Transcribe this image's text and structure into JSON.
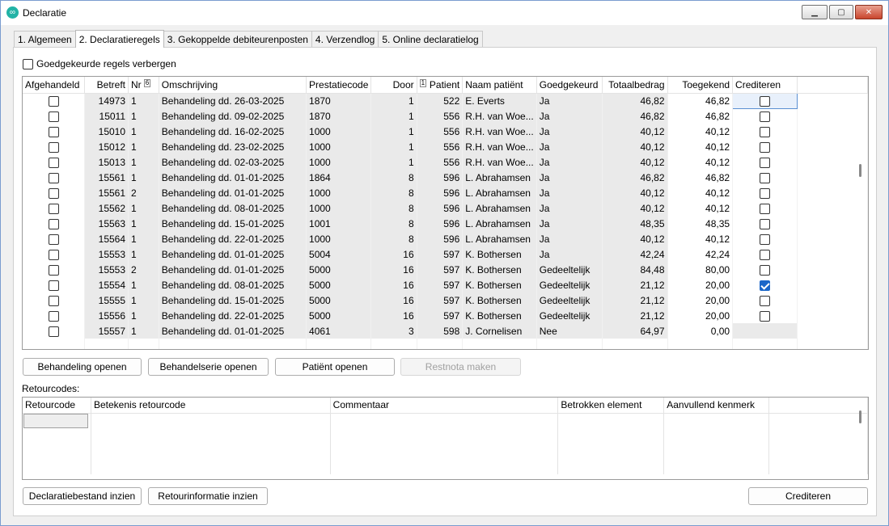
{
  "window": {
    "title": "Declaratie"
  },
  "tabs": [
    {
      "label": "1. Algemeen"
    },
    {
      "label": "2. Declaratieregels"
    },
    {
      "label": "3. Gekoppelde debiteurenposten"
    },
    {
      "label": "4. Verzendlog"
    },
    {
      "label": "5. Online declaratielog"
    }
  ],
  "filter": {
    "hide_approved_label": "Goedgekeurde regels verbergen"
  },
  "grid": {
    "columns": {
      "afgehandeld": "Afgehandeld",
      "betreft": "Betreft",
      "nr": "Nr",
      "nr_sort": "6",
      "omschrijving": "Omschrijving",
      "prestatiecode": "Prestatiecode",
      "door": "Door",
      "patient_sort": "1",
      "patient": "Patient",
      "naam": "Naam patiënt",
      "goedgekeurd": "Goedgekeurd",
      "totaalbedrag": "Totaalbedrag",
      "toegekend": "Toegekend",
      "crediteren": "Crediteren"
    },
    "rows": [
      {
        "betreft": "14973",
        "nr": "1",
        "omschrijving": "Behandeling dd. 26-03-2025",
        "prestatiecode": "1870",
        "door": "1",
        "patient": "522",
        "naam": "E. Everts",
        "goedgekeurd": "Ja",
        "totaalbedrag": "46,82",
        "toegekend": "46,82",
        "crediteren": false
      },
      {
        "betreft": "15011",
        "nr": "1",
        "omschrijving": "Behandeling dd. 09-02-2025",
        "prestatiecode": "1870",
        "door": "1",
        "patient": "556",
        "naam": "R.H. van Woe...",
        "goedgekeurd": "Ja",
        "totaalbedrag": "46,82",
        "toegekend": "46,82",
        "crediteren": false
      },
      {
        "betreft": "15010",
        "nr": "1",
        "omschrijving": "Behandeling dd. 16-02-2025",
        "prestatiecode": "1000",
        "door": "1",
        "patient": "556",
        "naam": "R.H. van Woe...",
        "goedgekeurd": "Ja",
        "totaalbedrag": "40,12",
        "toegekend": "40,12",
        "crediteren": false
      },
      {
        "betreft": "15012",
        "nr": "1",
        "omschrijving": "Behandeling dd. 23-02-2025",
        "prestatiecode": "1000",
        "door": "1",
        "patient": "556",
        "naam": "R.H. van Woe...",
        "goedgekeurd": "Ja",
        "totaalbedrag": "40,12",
        "toegekend": "40,12",
        "crediteren": false
      },
      {
        "betreft": "15013",
        "nr": "1",
        "omschrijving": "Behandeling dd. 02-03-2025",
        "prestatiecode": "1000",
        "door": "1",
        "patient": "556",
        "naam": "R.H. van Woe...",
        "goedgekeurd": "Ja",
        "totaalbedrag": "40,12",
        "toegekend": "40,12",
        "crediteren": false
      },
      {
        "betreft": "15561",
        "nr": "1",
        "omschrijving": "Behandeling dd. 01-01-2025",
        "prestatiecode": "1864",
        "door": "8",
        "patient": "596",
        "naam": "L. Abrahamsen",
        "goedgekeurd": "Ja",
        "totaalbedrag": "46,82",
        "toegekend": "46,82",
        "crediteren": false
      },
      {
        "betreft": "15561",
        "nr": "2",
        "omschrijving": "Behandeling dd. 01-01-2025",
        "prestatiecode": "1000",
        "door": "8",
        "patient": "596",
        "naam": "L. Abrahamsen",
        "goedgekeurd": "Ja",
        "totaalbedrag": "40,12",
        "toegekend": "40,12",
        "crediteren": false
      },
      {
        "betreft": "15562",
        "nr": "1",
        "omschrijving": "Behandeling dd. 08-01-2025",
        "prestatiecode": "1000",
        "door": "8",
        "patient": "596",
        "naam": "L. Abrahamsen",
        "goedgekeurd": "Ja",
        "totaalbedrag": "40,12",
        "toegekend": "40,12",
        "crediteren": false
      },
      {
        "betreft": "15563",
        "nr": "1",
        "omschrijving": "Behandeling dd. 15-01-2025",
        "prestatiecode": "1001",
        "door": "8",
        "patient": "596",
        "naam": "L. Abrahamsen",
        "goedgekeurd": "Ja",
        "totaalbedrag": "48,35",
        "toegekend": "48,35",
        "crediteren": false
      },
      {
        "betreft": "15564",
        "nr": "1",
        "omschrijving": "Behandeling dd. 22-01-2025",
        "prestatiecode": "1000",
        "door": "8",
        "patient": "596",
        "naam": "L. Abrahamsen",
        "goedgekeurd": "Ja",
        "totaalbedrag": "40,12",
        "toegekend": "40,12",
        "crediteren": false
      },
      {
        "betreft": "15553",
        "nr": "1",
        "omschrijving": "Behandeling dd. 01-01-2025",
        "prestatiecode": "5004",
        "door": "16",
        "patient": "597",
        "naam": "K. Bothersen",
        "goedgekeurd": "Ja",
        "totaalbedrag": "42,24",
        "toegekend": "42,24",
        "crediteren": false
      },
      {
        "betreft": "15553",
        "nr": "2",
        "omschrijving": "Behandeling dd. 01-01-2025",
        "prestatiecode": "5000",
        "door": "16",
        "patient": "597",
        "naam": "K. Bothersen",
        "goedgekeurd": "Gedeeltelijk",
        "totaalbedrag": "84,48",
        "toegekend": "80,00",
        "crediteren": false
      },
      {
        "betreft": "15554",
        "nr": "1",
        "omschrijving": "Behandeling dd. 08-01-2025",
        "prestatiecode": "5000",
        "door": "16",
        "patient": "597",
        "naam": "K. Bothersen",
        "goedgekeurd": "Gedeeltelijk",
        "totaalbedrag": "21,12",
        "toegekend": "20,00",
        "crediteren": true
      },
      {
        "betreft": "15555",
        "nr": "1",
        "omschrijving": "Behandeling dd. 15-01-2025",
        "prestatiecode": "5000",
        "door": "16",
        "patient": "597",
        "naam": "K. Bothersen",
        "goedgekeurd": "Gedeeltelijk",
        "totaalbedrag": "21,12",
        "toegekend": "20,00",
        "crediteren": false
      },
      {
        "betreft": "15556",
        "nr": "1",
        "omschrijving": "Behandeling dd. 22-01-2025",
        "prestatiecode": "5000",
        "door": "16",
        "patient": "597",
        "naam": "K. Bothersen",
        "goedgekeurd": "Gedeeltelijk",
        "totaalbedrag": "21,12",
        "toegekend": "20,00",
        "crediteren": false
      },
      {
        "betreft": "15557",
        "nr": "1",
        "omschrijving": "Behandeling dd. 01-01-2025",
        "prestatiecode": "4061",
        "door": "3",
        "patient": "598",
        "naam": "J. Cornelisen",
        "goedgekeurd": "Nee",
        "totaalbedrag": "64,97",
        "toegekend": "0,00",
        "crediteren": null
      }
    ]
  },
  "actions": {
    "behandeling_openen": "Behandeling openen",
    "behandelserie_openen": "Behandelserie openen",
    "patient_openen": "Patiënt openen",
    "restnota_maken": "Restnota maken"
  },
  "retourcodes": {
    "label": "Retourcodes:",
    "columns": {
      "retourcode": "Retourcode",
      "betekenis": "Betekenis retourcode",
      "commentaar": "Commentaar",
      "betrokken": "Betrokken element",
      "aanvullend": "Aanvullend kenmerk"
    }
  },
  "footer": {
    "declaratiebestand_inzien": "Declaratiebestand inzien",
    "retourinformatie_inzien": "Retourinformatie inzien",
    "crediteren": "Crediteren"
  }
}
